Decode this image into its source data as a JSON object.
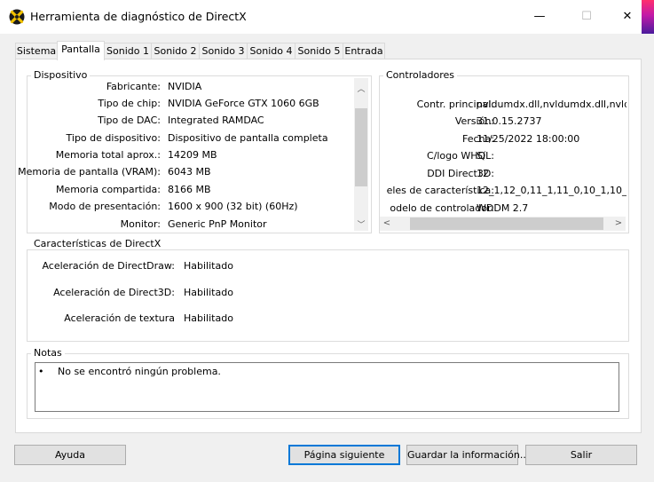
{
  "window": {
    "title": "Herramienta de diagnóstico de DirectX",
    "minimize": "—",
    "maximize": "☐",
    "close": "✕"
  },
  "tabs": [
    "Sistema",
    "Pantalla",
    "Sonido 1",
    "Sonido 2",
    "Sonido 3",
    "Sonido 4",
    "Sonido 5",
    "Entrada"
  ],
  "active_tab": "Pantalla",
  "device": {
    "title": "Dispositivo",
    "rows": [
      {
        "label": "Fabricante:",
        "value": "NVIDIA"
      },
      {
        "label": "Tipo de chip:",
        "value": "NVIDIA GeForce GTX 1060 6GB"
      },
      {
        "label": "Tipo de DAC:",
        "value": "Integrated RAMDAC"
      },
      {
        "label": "Tipo de dispositivo:",
        "value": "Dispositivo de pantalla completa"
      },
      {
        "label": "Memoria total aprox.:",
        "value": "14209 MB"
      },
      {
        "label": "Memoria de pantalla (VRAM):",
        "value": "6043 MB"
      },
      {
        "label": "Memoria compartida:",
        "value": "8166 MB"
      },
      {
        "label": "Modo de presentación:",
        "value": "1600 x 900 (32 bit) (60Hz)"
      },
      {
        "label": "Monitor:",
        "value": "Generic PnP Monitor"
      }
    ]
  },
  "drivers": {
    "title": "Controladores",
    "rows": [
      {
        "label": "Contr. principal:",
        "value": "nvldumdx.dll,nvldumdx.dll,nvldumd"
      },
      {
        "label": "Versión:",
        "value": "31.0.15.2737"
      },
      {
        "label": "Fecha:",
        "value": "11/25/2022 18:00:00"
      },
      {
        "label": "C/logo WHQL:",
        "value": "Sí"
      },
      {
        "label": "DDI Direct3D:",
        "value": "12"
      },
      {
        "label": "eles de característica:",
        "value": "12_1,12_0,11_1,11_0,10_1,10_0,"
      },
      {
        "label": "odelo de controlador:",
        "value": "WDDM 2.7"
      }
    ]
  },
  "features": {
    "title": "Características de DirectX",
    "rows": [
      {
        "label": "Aceleración de DirectDraw:",
        "value": "Habilitado"
      },
      {
        "label": "Aceleración de Direct3D:",
        "value": "Habilitado"
      },
      {
        "label": "Aceleración de textura",
        "value": "Habilitado"
      }
    ]
  },
  "notes": {
    "title": "Notas",
    "bullet": "•",
    "items": [
      "No se encontró ningún problema."
    ]
  },
  "buttons": {
    "help": "Ayuda",
    "next_page": "Página siguiente",
    "save_info": "Guardar la información...",
    "exit": "Salir"
  },
  "colors": {
    "panel_bg": "#ffffff",
    "window_bg": "#f0f0f0",
    "default_button_border": "#0078d7"
  }
}
